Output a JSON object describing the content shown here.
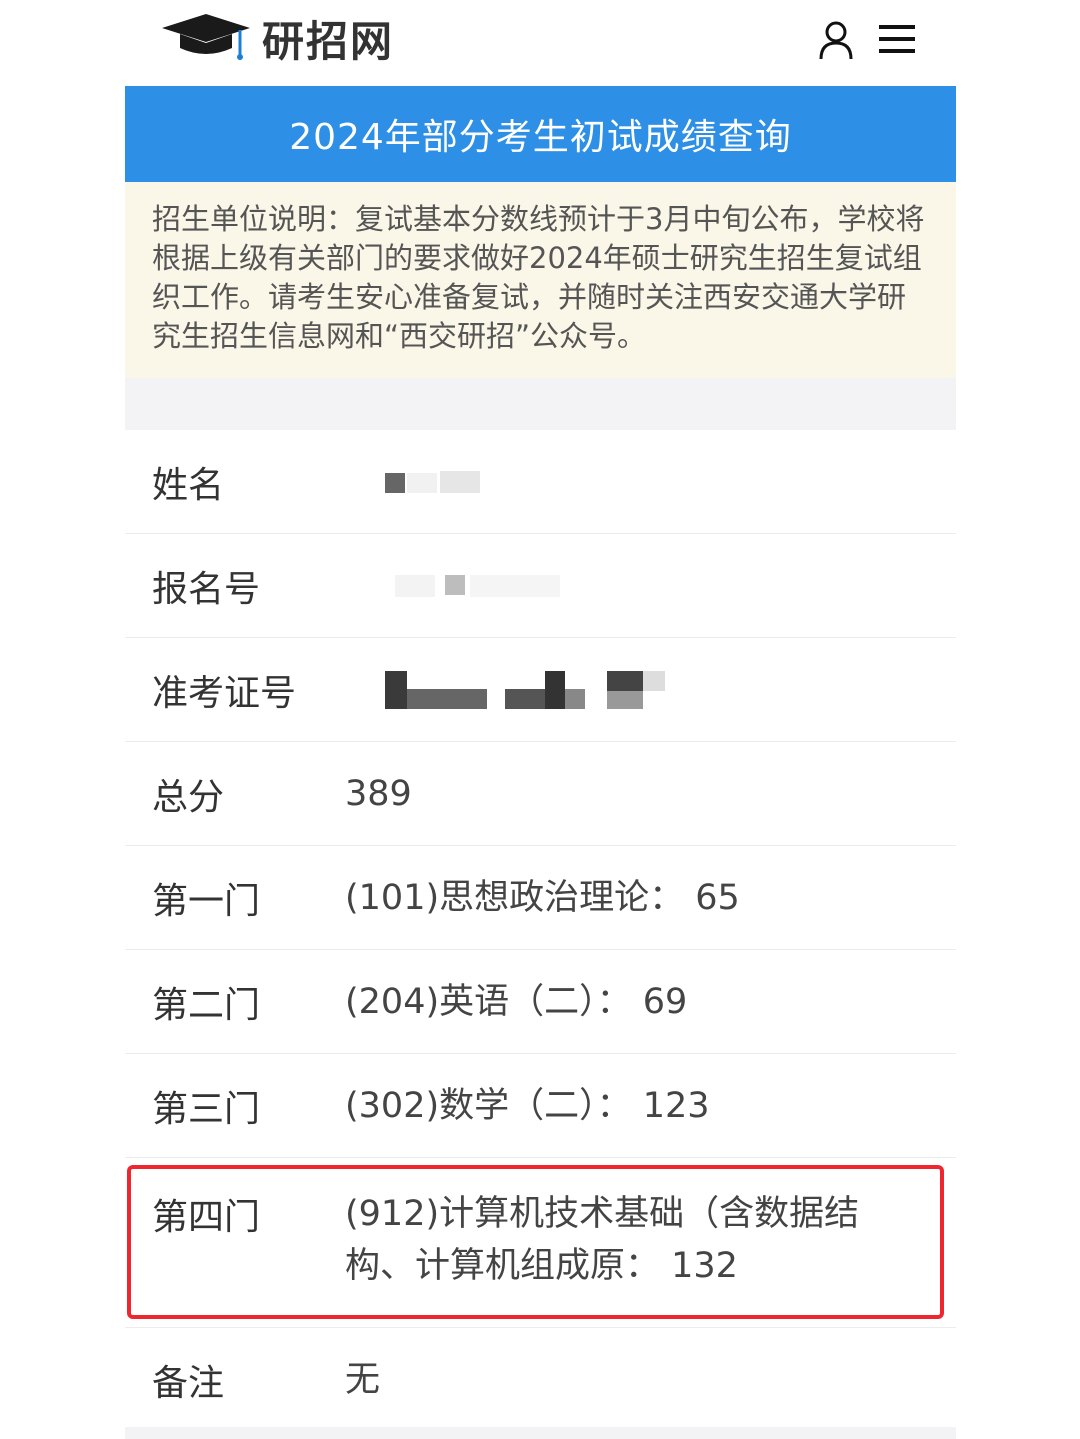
{
  "header": {
    "logo_text": "研招网",
    "logo_icon": "graduation-cap-icon",
    "user_icon": "user-icon",
    "menu_icon": "menu-icon"
  },
  "banner": {
    "title": "2024年部分考生初试成绩查询"
  },
  "notice": {
    "text": "招生单位说明：复试基本分数线预计于3月中旬公布，学校将根据上级有关部门的要求做好2024年硕士研究生招生复试组织工作。请考生安心准备复试，并随时关注西安交通大学研究生招生信息网和“西交研招”公众号。"
  },
  "fields": {
    "name_label": "姓名",
    "reg_label": "报名号",
    "ticket_label": "准考证号",
    "total_label": "总分",
    "total_value": "389",
    "subject1_label": "第一门",
    "subject1_value": "(101)思想政治理论：  65",
    "subject2_label": "第二门",
    "subject2_value": "(204)英语（二）：  69",
    "subject3_label": "第三门",
    "subject3_value": "(302)数学（二）：  123",
    "subject4_label": "第四门",
    "subject4_value": "(912)计算机技术基础（含数据结构、计算机组成原：  132",
    "remark_label": "备注",
    "remark_value": "无"
  },
  "colors": {
    "banner_bg": "#2e8fe6",
    "notice_bg": "#fbf7e8",
    "highlight_border": "#f0262f"
  }
}
